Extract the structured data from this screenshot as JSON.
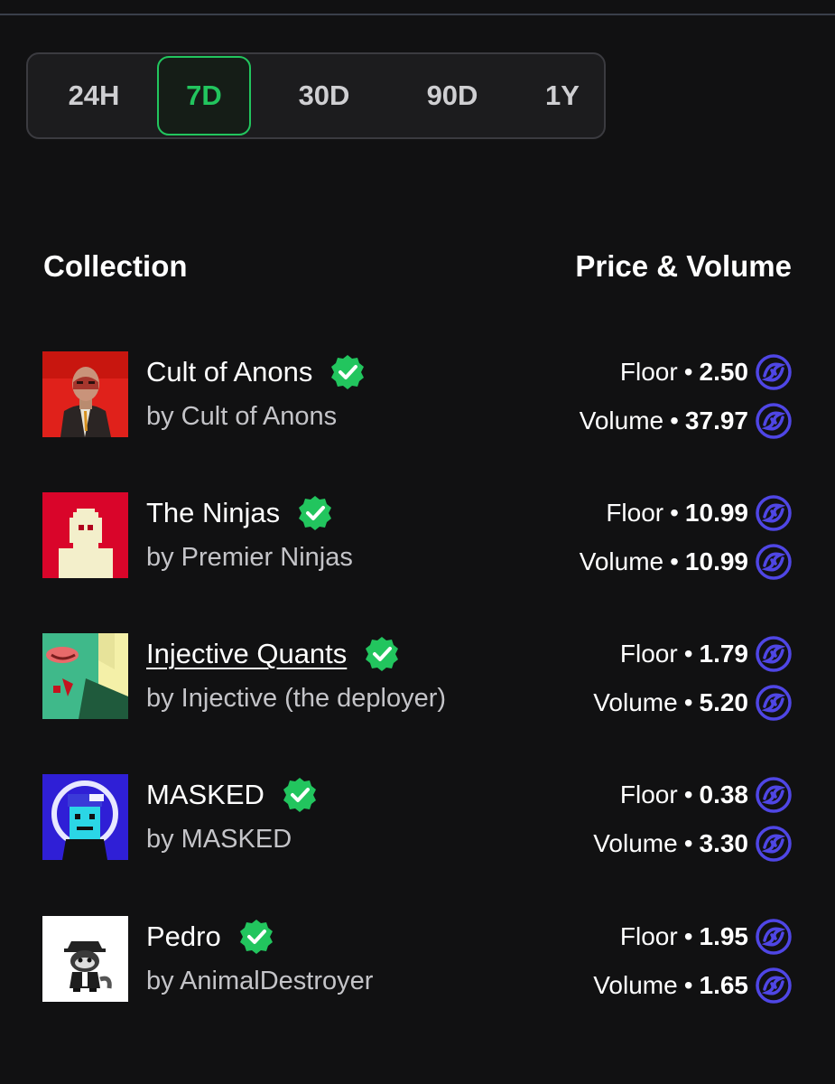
{
  "periods": [
    "24H",
    "7D",
    "30D",
    "90D",
    "1Y"
  ],
  "selected_period": "7D",
  "headers": {
    "collection": "Collection",
    "price_volume": "Price & Volume"
  },
  "colors": {
    "accent": "#22c55e",
    "background": "#111112",
    "token": "#4f46e5"
  },
  "collections": [
    {
      "name": "Cult of Anons",
      "creator": "by Cult of Anons",
      "verified": true,
      "floor_label": "Floor",
      "floor": "2.50",
      "volume_label": "Volume",
      "volume": "37.97",
      "token_icon": "injective-icon"
    },
    {
      "name": "The Ninjas",
      "creator": "by Premier Ninjas",
      "verified": true,
      "floor_label": "Floor",
      "floor": "10.99",
      "volume_label": "Volume",
      "volume": "10.99",
      "token_icon": "injective-icon"
    },
    {
      "name": "Injective Quants",
      "creator": "by Injective (the deployer)",
      "verified": true,
      "floor_label": "Floor",
      "floor": "1.79",
      "volume_label": "Volume",
      "volume": "5.20",
      "token_icon": "injective-icon"
    },
    {
      "name": "MASKED",
      "creator": "by MASKED",
      "verified": true,
      "floor_label": "Floor",
      "floor": "0.38",
      "volume_label": "Volume",
      "volume": "3.30",
      "token_icon": "injective-icon"
    },
    {
      "name": "Pedro",
      "creator": "by AnimalDestroyer",
      "verified": true,
      "floor_label": "Floor",
      "floor": "1.95",
      "volume_label": "Volume",
      "volume": "1.65",
      "token_icon": "injective-icon"
    }
  ]
}
